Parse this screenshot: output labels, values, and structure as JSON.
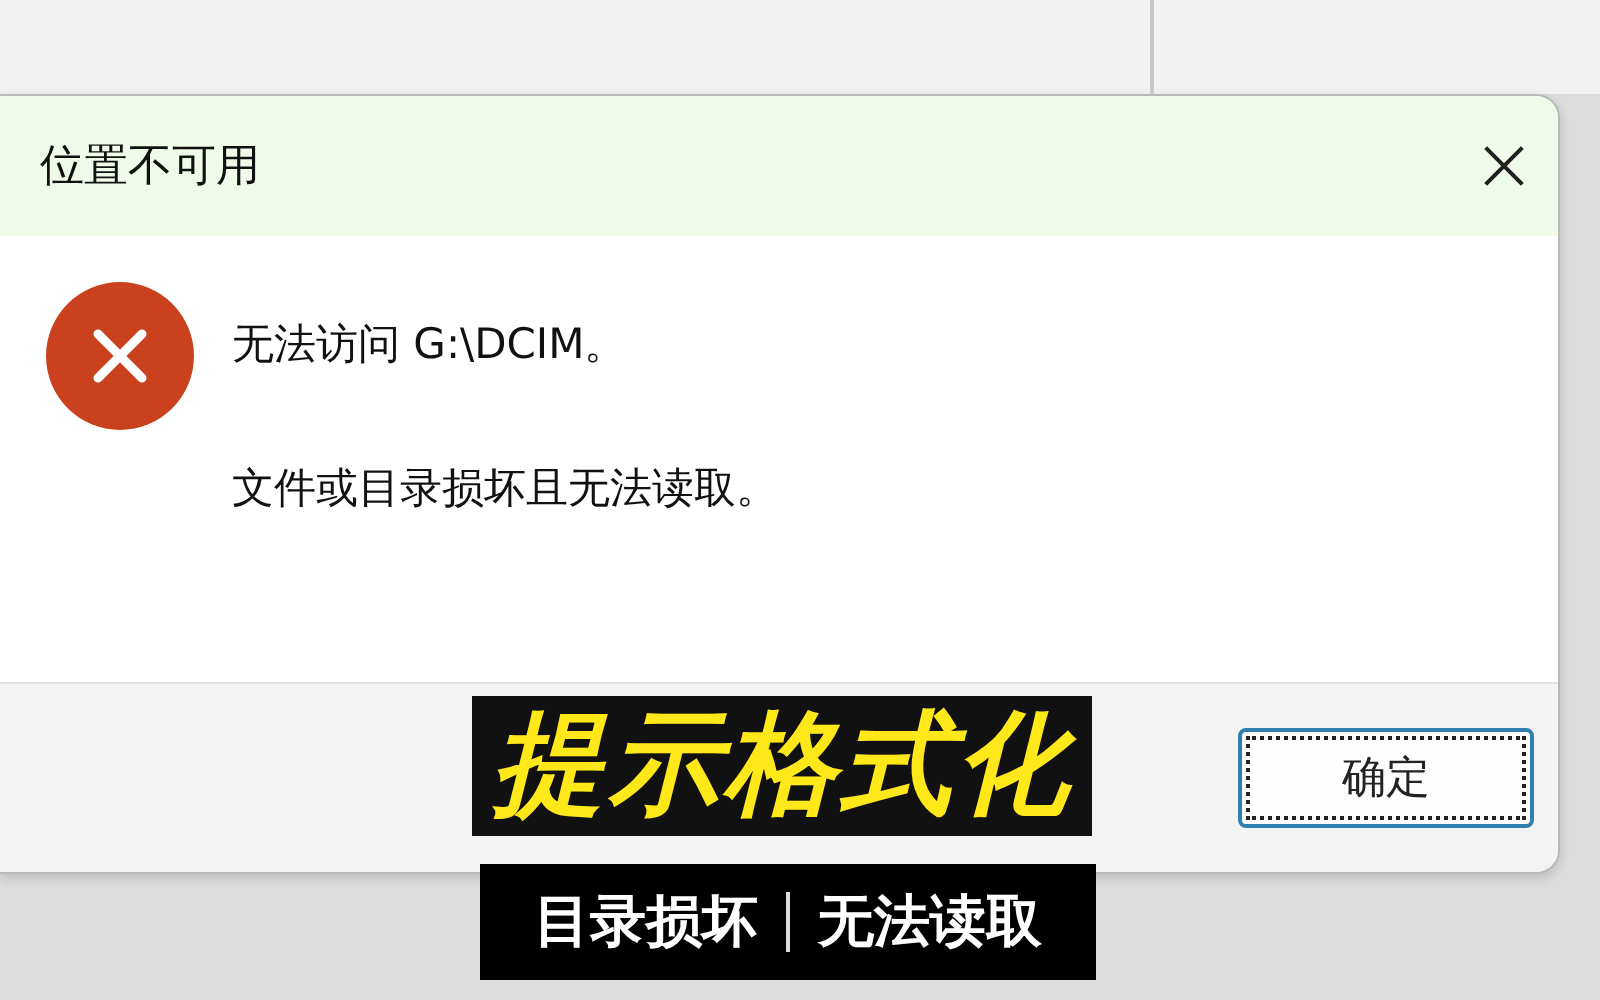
{
  "dialog": {
    "title": "位置不可用",
    "messages": [
      "无法访问 G:\\DCIM。",
      "文件或目录损坏且无法读取。"
    ],
    "buttons": [
      {
        "label": "确定",
        "focused": true
      }
    ]
  },
  "captions": [
    {
      "kind": "headline",
      "parts": [
        "提示格式化"
      ]
    },
    {
      "kind": "banner",
      "parts": [
        "目录损坏",
        "无法读取"
      ]
    }
  ]
}
